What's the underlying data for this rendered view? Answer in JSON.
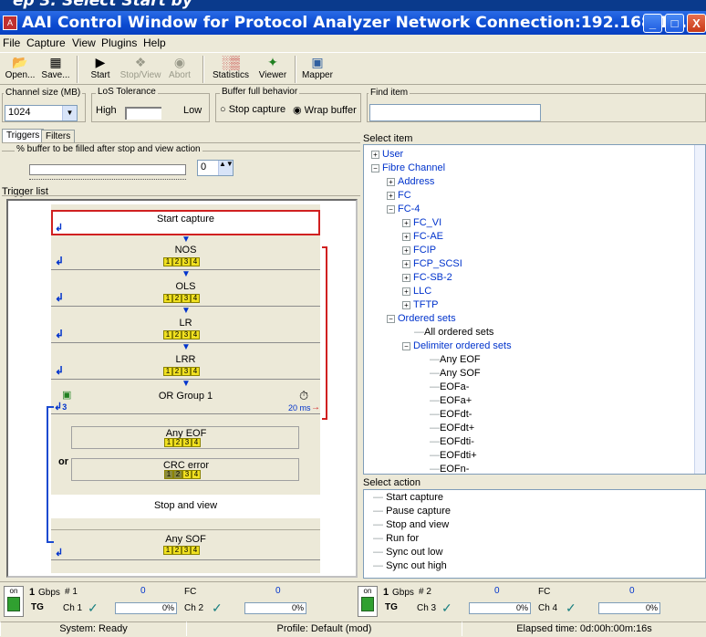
{
  "top_strip_text": "ep 3: Select Start by",
  "window": {
    "title": "AAI Control Window for Protocol Analyzer  Network Connection:192.168.1....",
    "min": "_",
    "max": "□",
    "close": "X"
  },
  "menu": [
    "File",
    "Capture",
    "View",
    "Plugins",
    "Help"
  ],
  "toolbar": {
    "open": "Open...",
    "save": "Save...",
    "start": "Start",
    "stop_view": "Stop/View",
    "abort": "Abort",
    "statistics": "Statistics",
    "viewer": "Viewer",
    "mapper": "Mapper"
  },
  "options": {
    "channel_size_label": "Channel size (MB)",
    "channel_size_value": "1024",
    "los_label": "LoS Tolerance",
    "los_high": "High",
    "los_low": "Low",
    "buffer_label": "Buffer full behavior",
    "stop_capture": "Stop capture",
    "wrap_buffer": "Wrap buffer",
    "find_label": "Find item",
    "find_value": ""
  },
  "tabs": {
    "triggers": "Triggers",
    "filters": "Filters"
  },
  "buffer_fill_label": "% buffer to be filled after stop and view action",
  "buffer_fill_value": "0",
  "trigger_list_label": "Trigger list",
  "triggers": {
    "start_capture": "Start capture",
    "rows": [
      "NOS",
      "OLS",
      "LR",
      "LRR"
    ],
    "port_chips": [
      "1",
      "2",
      "3",
      "4"
    ],
    "or_group": "OR Group 1",
    "or_group_count": "3",
    "timer": "20 ms",
    "any_eof": "Any EOF",
    "crc_error": "CRC error",
    "or_label": "or",
    "stop_and_view": "Stop and view",
    "any_sof": "Any SOF"
  },
  "select_item_label": "Select item",
  "tree": [
    {
      "label": "User",
      "pm": "+",
      "depth": 0,
      "blue": true
    },
    {
      "label": "Fibre Channel",
      "pm": "−",
      "depth": 0,
      "blue": true
    },
    {
      "label": "Address",
      "pm": "+",
      "depth": 1,
      "blue": true
    },
    {
      "label": "FC",
      "pm": "+",
      "depth": 1,
      "blue": true
    },
    {
      "label": "FC-4",
      "pm": "−",
      "depth": 1,
      "blue": true
    },
    {
      "label": "FC_VI",
      "pm": "+",
      "depth": 2,
      "blue": true
    },
    {
      "label": "FC-AE",
      "pm": "+",
      "depth": 2,
      "blue": true
    },
    {
      "label": "FCIP",
      "pm": "+",
      "depth": 2,
      "blue": true
    },
    {
      "label": "FCP_SCSI",
      "pm": "+",
      "depth": 2,
      "blue": true
    },
    {
      "label": "FC-SB-2",
      "pm": "+",
      "depth": 2,
      "blue": true
    },
    {
      "label": "LLC",
      "pm": "+",
      "depth": 2,
      "blue": true
    },
    {
      "label": "TFTP",
      "pm": "+",
      "depth": 2,
      "blue": true
    },
    {
      "label": "Ordered sets",
      "pm": "−",
      "depth": 1,
      "blue": true
    },
    {
      "label": "All ordered sets",
      "pm": "",
      "depth": 2,
      "blue": false
    },
    {
      "label": "Delimiter ordered sets",
      "pm": "−",
      "depth": 2,
      "blue": true
    },
    {
      "label": "Any EOF",
      "pm": "",
      "depth": 3,
      "blue": false
    },
    {
      "label": "Any SOF",
      "pm": "",
      "depth": 3,
      "blue": false
    },
    {
      "label": "EOFa-",
      "pm": "",
      "depth": 3,
      "blue": false
    },
    {
      "label": "EOFa+",
      "pm": "",
      "depth": 3,
      "blue": false
    },
    {
      "label": "EOFdt-",
      "pm": "",
      "depth": 3,
      "blue": false
    },
    {
      "label": "EOFdt+",
      "pm": "",
      "depth": 3,
      "blue": false
    },
    {
      "label": "EOFdti-",
      "pm": "",
      "depth": 3,
      "blue": false
    },
    {
      "label": "EOFdti+",
      "pm": "",
      "depth": 3,
      "blue": false
    },
    {
      "label": "EOFn-",
      "pm": "",
      "depth": 3,
      "blue": false
    }
  ],
  "select_action_label": "Select action",
  "actions": [
    "Start capture",
    "Pause capture",
    "Stop and view",
    "Run for",
    "Sync out low",
    "Sync out high"
  ],
  "ports": [
    {
      "on": "on",
      "speed": "1",
      "unit": "Gbps",
      "num": "# 1",
      "tg": "TG",
      "chA": "Ch 1",
      "valA": "0",
      "pctA": "0%",
      "proto": "FC",
      "chB": "Ch 2",
      "valB": "0",
      "pctB": "0%"
    },
    {
      "on": "on",
      "speed": "1",
      "unit": "Gbps",
      "num": "# 2",
      "tg": "TG",
      "chA": "Ch 3",
      "valA": "0",
      "pctA": "0%",
      "proto": "FC",
      "chB": "Ch 4",
      "valB": "0",
      "pctB": "0%"
    }
  ],
  "status": {
    "system": "System: Ready",
    "profile": "Profile: Default (mod)",
    "elapsed": "Elapsed time: 0d:00h:00m:16s"
  }
}
